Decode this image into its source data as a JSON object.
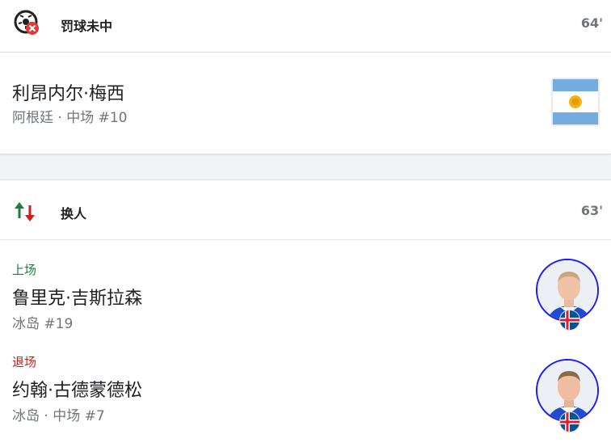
{
  "event1": {
    "title": "罚球未中",
    "minute": "64'",
    "icon": "missed-penalty-icon",
    "player": {
      "name": "利昂内尔·梅西",
      "meta": "阿根廷 · 中场 #10",
      "flag": "argentina-flag"
    }
  },
  "event2": {
    "title": "换人",
    "minute": "63'",
    "icon": "substitution-icon",
    "player_in": {
      "role": "上场",
      "name": "鲁里克·吉斯拉森",
      "meta": "冰岛 #19",
      "flag": "iceland-flag"
    },
    "player_out": {
      "role": "退场",
      "name": "约翰·古德蒙德松",
      "meta": "冰岛 · 中场 #7",
      "flag": "iceland-flag"
    }
  },
  "colors": {
    "in": "#188038",
    "out": "#c5221f",
    "avatar_ring": "#1a1aff",
    "minute": "#70757a"
  }
}
